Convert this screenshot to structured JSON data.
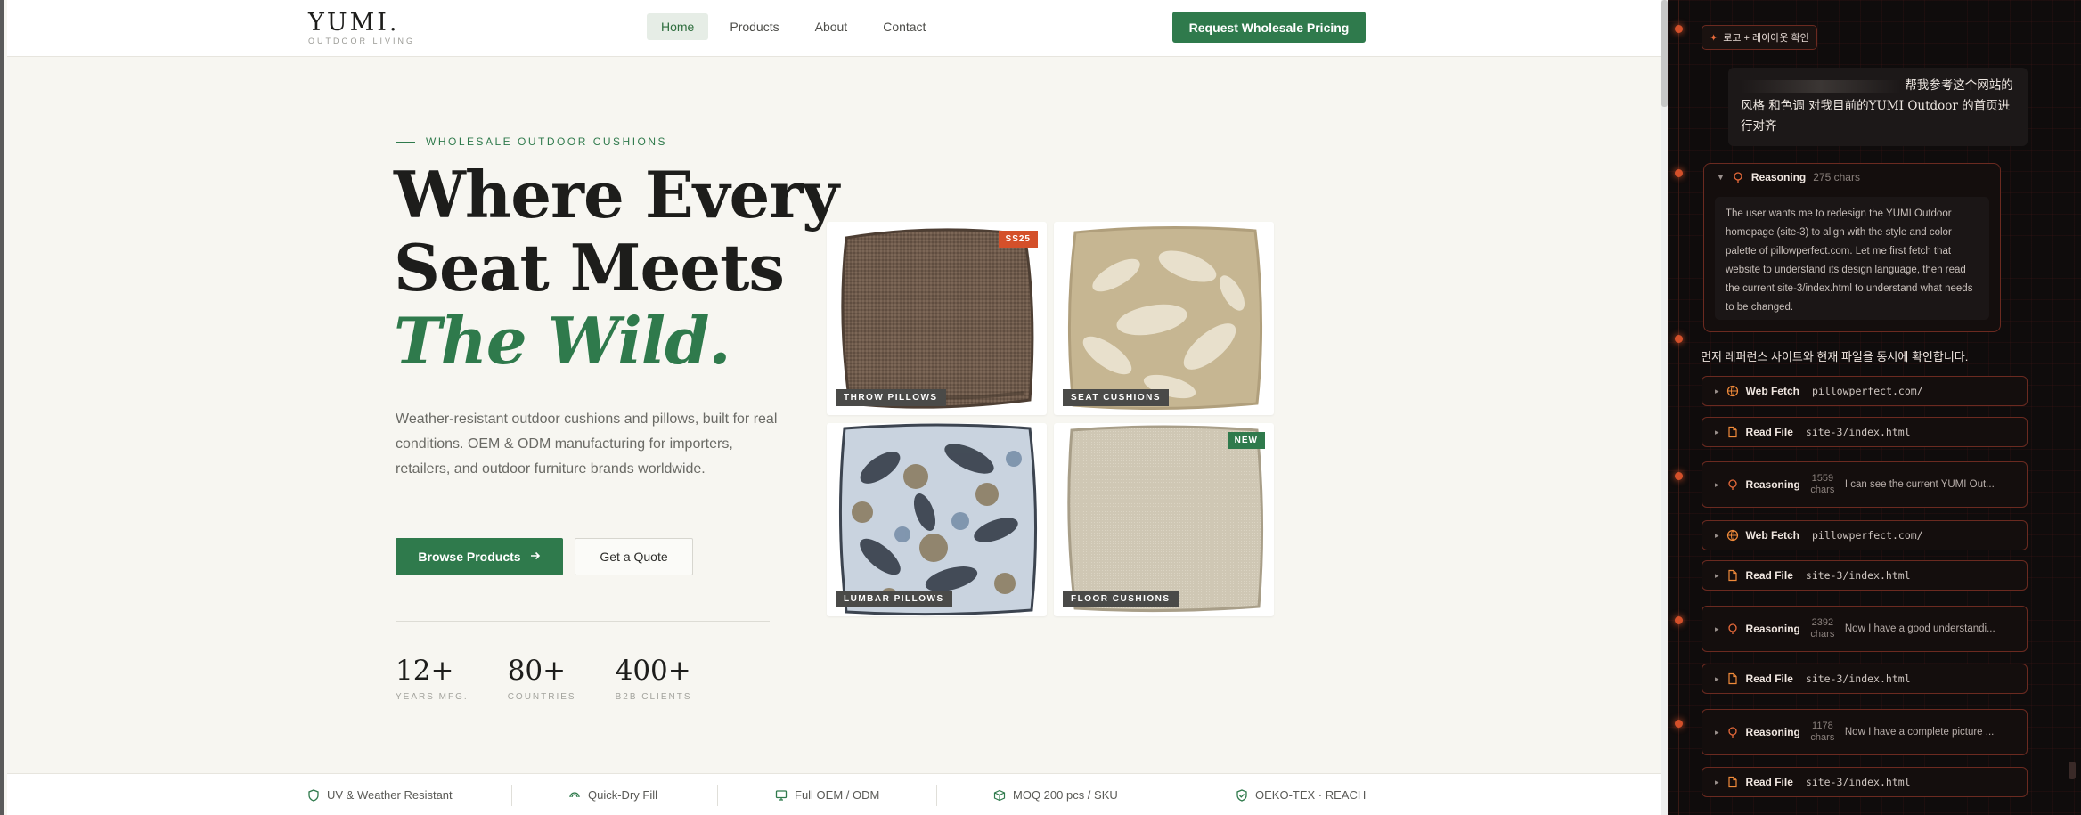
{
  "site": {
    "logo": {
      "main": "YUMI.",
      "sub": "OUTDOOR LIVING"
    },
    "nav": {
      "links": [
        {
          "label": "Home",
          "active": true
        },
        {
          "label": "Products",
          "active": false
        },
        {
          "label": "About",
          "active": false
        },
        {
          "label": "Contact",
          "active": false
        }
      ],
      "cta": "Request Wholesale Pricing"
    },
    "hero": {
      "eyebrow": "WHOLESALE OUTDOOR CUSHIONS",
      "headline_1": "Where Every",
      "headline_2": "Seat Meets",
      "headline_accent": "The Wild.",
      "lede": "Weather-resistant outdoor cushions and pillows, built for real conditions. OEM & ODM manufacturing for importers, retailers, and outdoor furniture brands worldwide.",
      "primary_button": "Browse Products",
      "secondary_button": "Get a Quote"
    },
    "stats": [
      {
        "value": "12+",
        "label": "YEARS MFG."
      },
      {
        "value": "80+",
        "label": "COUNTRIES"
      },
      {
        "value": "400+",
        "label": "B2B CLIENTS"
      }
    ],
    "products": [
      {
        "tag": "THROW PILLOWS",
        "badge": "SS25",
        "badge_color": "#d4502a"
      },
      {
        "tag": "SEAT CUSHIONS",
        "badge": "",
        "badge_color": ""
      },
      {
        "tag": "LUMBAR PILLOWS",
        "badge": "",
        "badge_color": ""
      },
      {
        "tag": "FLOOR CUSHIONS",
        "badge": "NEW",
        "badge_color": "#2f7a4c"
      }
    ],
    "features": [
      {
        "label": "UV & Weather Resistant",
        "icon": "shield-icon"
      },
      {
        "label": "Quick-Dry Fill",
        "icon": "drop-icon"
      },
      {
        "label": "Full OEM / ODM",
        "icon": "monitor-icon"
      },
      {
        "label": "MOQ 200 pcs / SKU",
        "icon": "box-icon"
      },
      {
        "label": "OEKO-TEX · REACH",
        "icon": "check-shield-icon"
      }
    ]
  },
  "panel": {
    "pill": "로고 + 레이아웃 확인",
    "user_message": "帮我参考这个网站的风格 和色调 对我目前的YUMI Outdoor 的首页进行对齐",
    "reasoning_open": {
      "label": "Reasoning",
      "count": "275 chars",
      "body": "The user wants me to redesign the YUMI Outdoor homepage (site-3) to align with the style and color palette of pillowperfect.com. Let me first fetch that website to understand its design language, then read the current site-3/index.html to understand what needs to be changed."
    },
    "korean_note": "먼저 레퍼런스 사이트와 현재 파일을 동시에 확인합니다.",
    "steps": [
      {
        "type": "fetch",
        "label": "Web Fetch",
        "arg": "pillowperfect.com/"
      },
      {
        "type": "file",
        "label": "Read File",
        "arg": "site-3/index.html"
      },
      {
        "type": "reasoning",
        "label": "Reasoning",
        "count": "1559 chars",
        "snippet": "I can see the current YUMI Out..."
      },
      {
        "type": "fetch",
        "label": "Web Fetch",
        "arg": "pillowperfect.com/"
      },
      {
        "type": "file",
        "label": "Read File",
        "arg": "site-3/index.html"
      },
      {
        "type": "reasoning",
        "label": "Reasoning",
        "count": "2392 chars",
        "snippet": "Now I have a good understandi..."
      },
      {
        "type": "file",
        "label": "Read File",
        "arg": "site-3/index.html"
      },
      {
        "type": "reasoning",
        "label": "Reasoning",
        "count": "1178 chars",
        "snippet": "Now I have a complete picture ..."
      },
      {
        "type": "file",
        "label": "Read File",
        "arg": "site-3/index.html"
      }
    ]
  }
}
